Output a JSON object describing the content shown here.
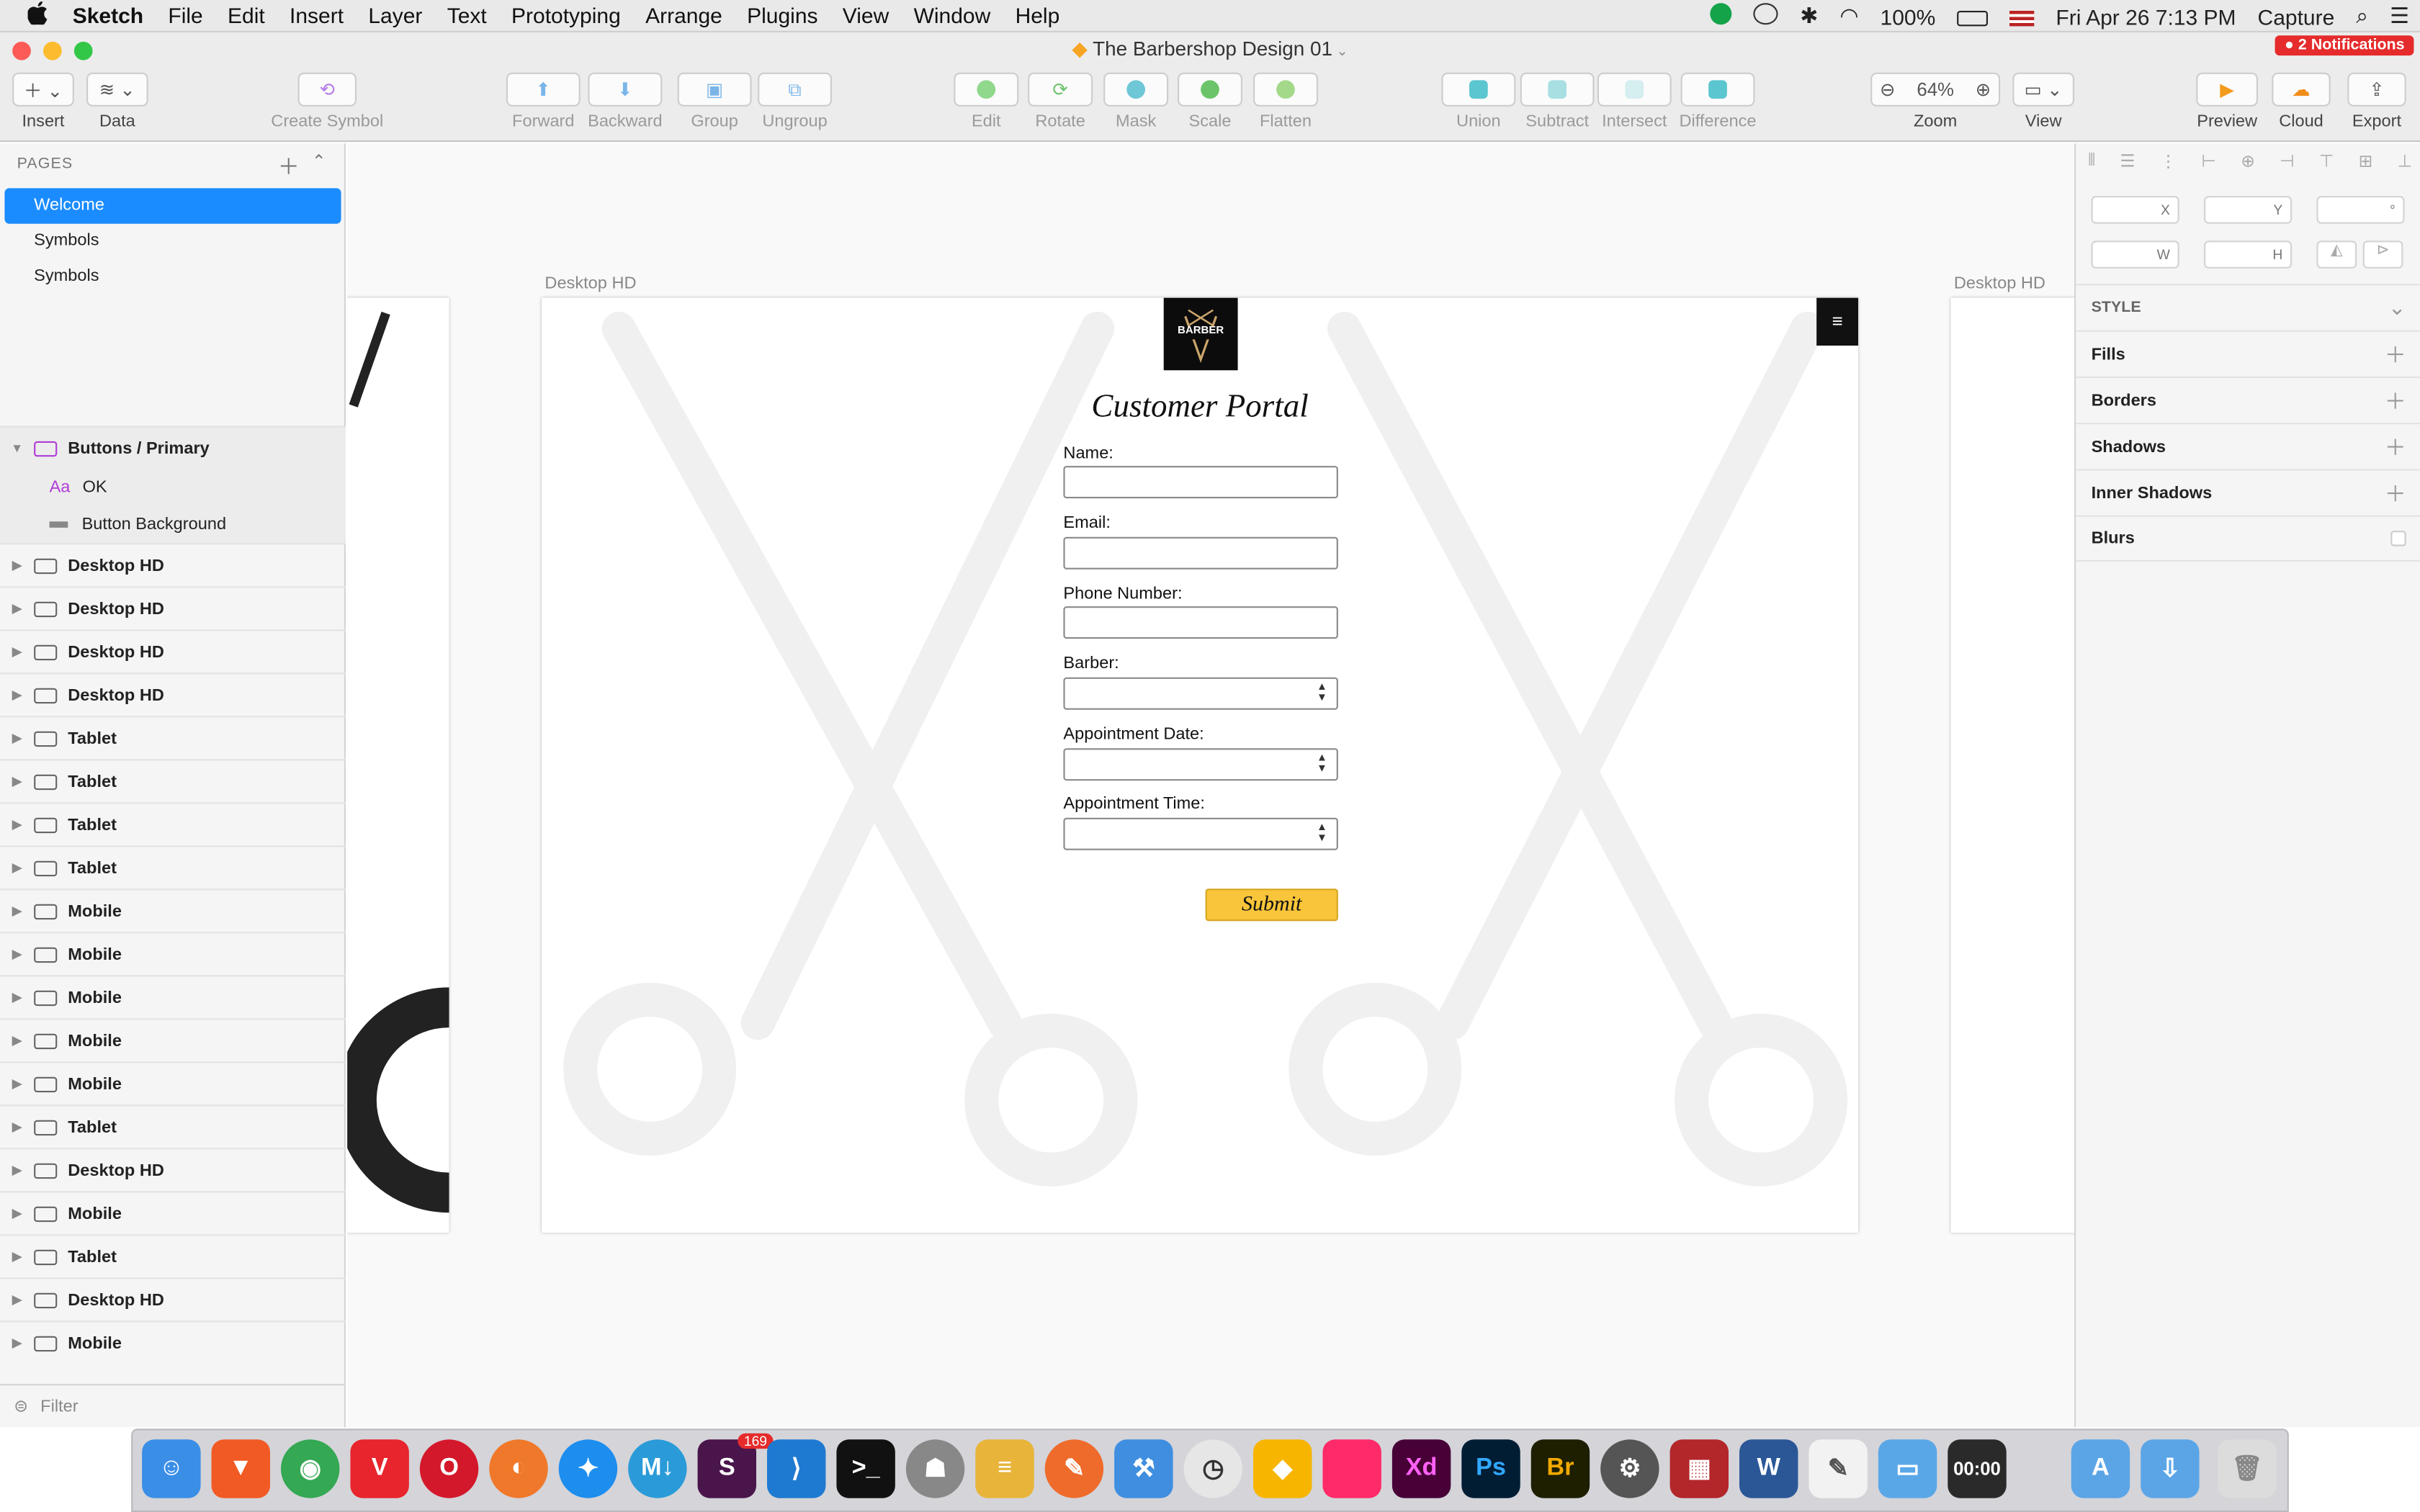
{
  "menubar": {
    "app_name": "Sketch",
    "items": [
      "File",
      "Edit",
      "Insert",
      "Layer",
      "Text",
      "Prototyping",
      "Arrange",
      "Plugins",
      "View",
      "Window",
      "Help"
    ],
    "battery": "100%",
    "datetime": "Fri Apr 26  7:13 PM",
    "capture": "Capture"
  },
  "window": {
    "title": "The Barbershop Design 01",
    "notifications": "2 Notifications"
  },
  "toolbar": {
    "insert": "Insert",
    "data": "Data",
    "create_symbol": "Create Symbol",
    "forward": "Forward",
    "backward": "Backward",
    "group": "Group",
    "ungroup": "Ungroup",
    "edit": "Edit",
    "rotate": "Rotate",
    "mask": "Mask",
    "scale": "Scale",
    "flatten": "Flatten",
    "union": "Union",
    "subtract": "Subtract",
    "intersect": "Intersect",
    "difference": "Difference",
    "zoom_value": "64%",
    "zoom": "Zoom",
    "view": "View",
    "preview": "Preview",
    "cloud": "Cloud",
    "export": "Export"
  },
  "sidebar": {
    "pages_header": "PAGES",
    "pages": [
      "Welcome",
      "Symbols",
      "Symbols"
    ],
    "layers": {
      "group": "Buttons / Primary",
      "children": [
        "OK",
        "Button Background"
      ],
      "artboards": [
        "Desktop HD",
        "Desktop HD",
        "Desktop HD",
        "Desktop HD",
        "Tablet",
        "Tablet",
        "Tablet",
        "Tablet",
        "Mobile",
        "Mobile",
        "Mobile",
        "Mobile",
        "Mobile",
        "Tablet",
        "Desktop HD",
        "Mobile",
        "Tablet",
        "Desktop HD",
        "Mobile"
      ]
    },
    "filter": "Filter"
  },
  "canvas": {
    "artboard_label": "Desktop HD",
    "artboard_label_right": "Desktop HD",
    "portal": {
      "title": "Customer Portal",
      "fields": [
        {
          "label": "Name:",
          "type": "text"
        },
        {
          "label": "Email:",
          "type": "text"
        },
        {
          "label": "Phone Number:",
          "type": "text"
        },
        {
          "label": "Barber:",
          "type": "select"
        },
        {
          "label": "Appointment Date:",
          "type": "select"
        },
        {
          "label": "Appointment Time:",
          "type": "select"
        }
      ],
      "submit": "Submit",
      "menu_icon": "≡",
      "logo_text": "BARBER"
    }
  },
  "inspector": {
    "x": "X",
    "y": "Y",
    "rot": "°",
    "w": "W",
    "h": "H",
    "style": "STYLE",
    "sections": [
      "Fills",
      "Borders",
      "Shadows",
      "Inner Shadows",
      "Blurs"
    ]
  },
  "dock": {
    "badge": "169",
    "clock": "00:00"
  },
  "colors": {
    "accent": "#1a8cff",
    "submit": "#f9c53a",
    "notification": "#e52b2b"
  }
}
